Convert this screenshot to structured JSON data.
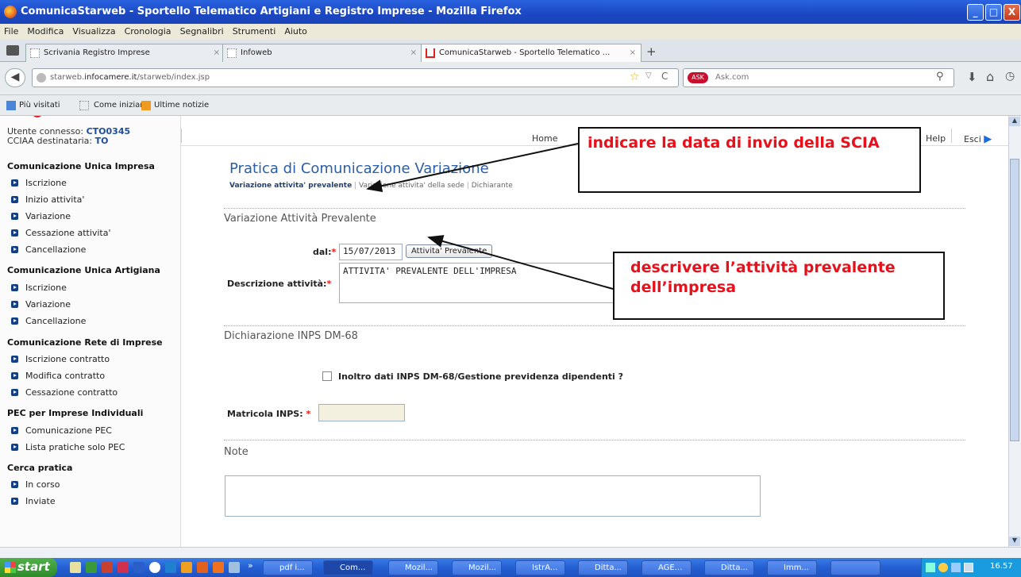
{
  "window": {
    "title": "ComunicaStarweb - Sportello Telematico Artigiani e Registro Imprese - Mozilla Firefox",
    "min_label": "_",
    "max_label": "□",
    "close_label": "X"
  },
  "menu": [
    "File",
    "Modifica",
    "Visualizza",
    "Cronologia",
    "Segnalibri",
    "Strumenti",
    "Aiuto"
  ],
  "tabs": [
    {
      "label": "Scrivania Registro Imprese"
    },
    {
      "label": "Infoweb"
    },
    {
      "label": "ComunicaStarweb - Sportello Telematico ..."
    }
  ],
  "tab_close": "×",
  "new_tab": "+",
  "nav": {
    "url_prefix": "starweb.",
    "url_host": "infocamere.it",
    "url_path": "/starweb/index.jsp",
    "search_placeholder": "Ask.com"
  },
  "bookmarks": [
    "Più visitati",
    "Come iniziare",
    "Ultime notizie"
  ],
  "user": {
    "connected_label": "Utente connesso:",
    "connected_value": "CTO0345",
    "cciaa_label": "CCIAA destinataria:",
    "cciaa_value": "TO"
  },
  "topnav": {
    "home": "Home",
    "help": "Help",
    "exit": "Esci"
  },
  "sidebar": {
    "sections": [
      {
        "title": "Comunicazione Unica Impresa",
        "items": [
          "Iscrizione",
          "Inizio attivita'",
          "Variazione",
          "Cessazione attivita'",
          "Cancellazione"
        ]
      },
      {
        "title": "Comunicazione Unica Artigiana",
        "items": [
          "Iscrizione",
          "Variazione",
          "Cancellazione"
        ]
      },
      {
        "title": "Comunicazione Rete di Imprese",
        "items": [
          "Iscrizione contratto",
          "Modifica contratto",
          "Cessazione contratto"
        ]
      },
      {
        "title": "PEC per Imprese Individuali",
        "items": [
          "Comunicazione PEC",
          "Lista pratiche solo PEC"
        ]
      },
      {
        "title": "Cerca pratica",
        "items": [
          "In corso",
          "Inviate"
        ]
      }
    ]
  },
  "main": {
    "page_title": "Pratica di Comunicazione Variazione",
    "subtab_active": "Variazione attivita' prevalente",
    "subtab_2": "Variazione attivita' della sede",
    "subtab_3": "Dichiarante",
    "subtab_sep": "|",
    "section1": "Variazione Attività Prevalente",
    "dal_label": "dal:",
    "dal_value": "15/07/2013",
    "attivita_button": "Attivita' Prevalente",
    "descr_label": "Descrizione attività:",
    "descr_value": "ATTIVITA' PREVALENTE DELL'IMPRESA",
    "section2": "Dichiarazione INPS DM-68",
    "inps_check_label": "Inoltro dati INPS DM-68/Gestione previdenza dipendenti ?",
    "matricola_label": "Matricola INPS:",
    "section3": "Note",
    "required_mark": "*"
  },
  "callouts": {
    "date": "indicare la data di invio della SCIA",
    "activity": "descrivere l’attività prevalente dell’impresa"
  },
  "taskbar": {
    "start": "start",
    "tasks": [
      "pdf i...",
      "Com...",
      "Mozil...",
      "Mozil...",
      "IstrA...",
      "Ditta...",
      "AGE...",
      "Ditta...",
      "Imm..."
    ],
    "clock": "16.57"
  },
  "colors": {
    "accent": "#2a5ea6",
    "callout_text": "#e8101a",
    "required": "#e02020"
  }
}
